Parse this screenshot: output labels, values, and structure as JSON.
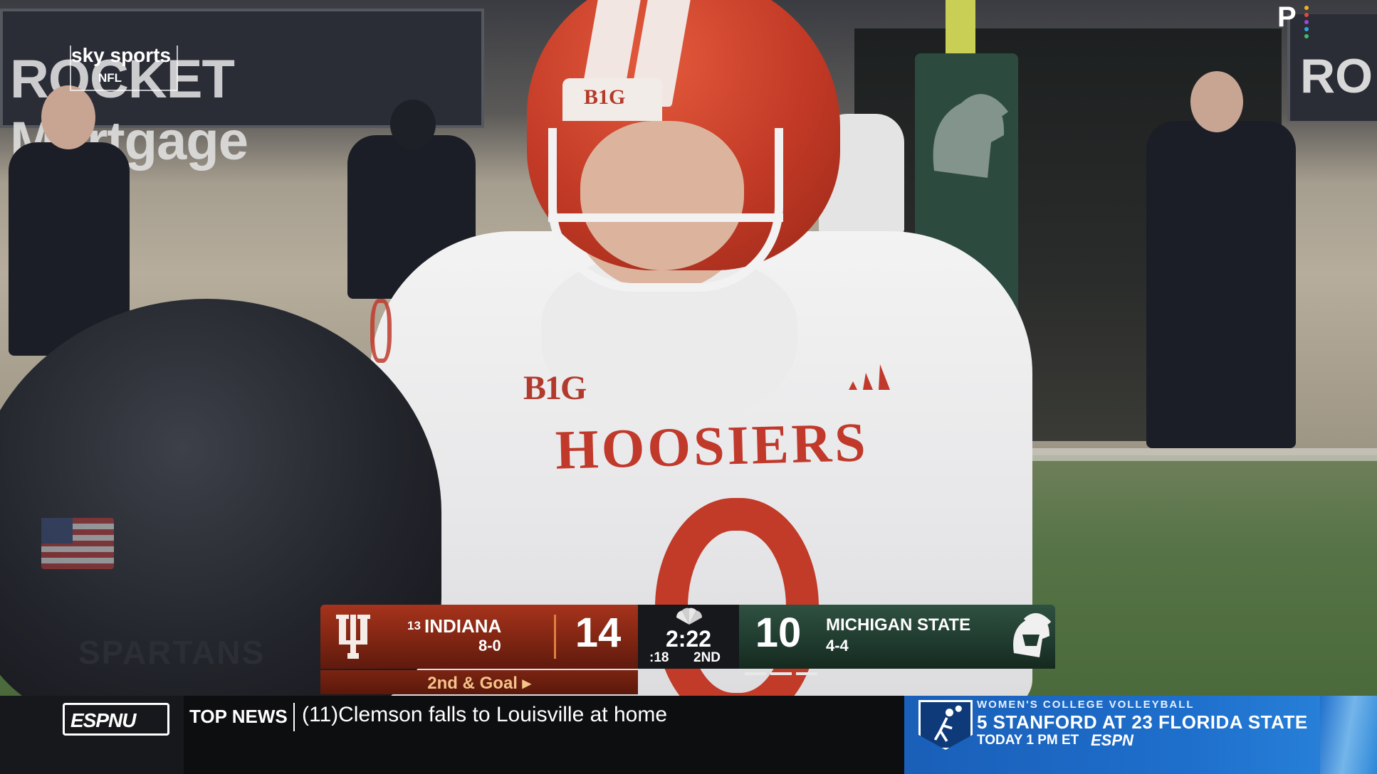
{
  "broadcast": {
    "sky_logo": "sky sports",
    "sky_sub": "NFL",
    "peacock_logo": "P"
  },
  "scene": {
    "ad_board_left": "ROCKET Mortgage",
    "ad_board_right": "RO",
    "helmet_logo": "B1G",
    "jersey_logo": "B1G",
    "jersey_text": "HOOSIERS",
    "fg_helmet_text": "SPARTANS"
  },
  "scorebug": {
    "home": {
      "rank": "13",
      "name": "INDIANA",
      "record": "8-0",
      "score": "14",
      "color": "#9a2e19"
    },
    "clock": "2:22",
    "play_clock": ":18",
    "quarter": "2ND",
    "away": {
      "name": "MICHIGAN STATE",
      "record": "4-4",
      "score": "10",
      "color": "#1f3a2e"
    },
    "down_distance": "2nd & Goal ▸"
  },
  "ticker": {
    "network_logo": "ESPNU",
    "label": "TOP NEWS",
    "headline": "(11)Clemson falls to Louisville at home",
    "promo": {
      "eyebrow": "WOMEN'S COLLEGE VOLLEYBALL",
      "matchup": "5 STANFORD AT 23 FLORIDA STATE",
      "time": "TODAY 1 PM ET",
      "network": "ESPN"
    }
  }
}
